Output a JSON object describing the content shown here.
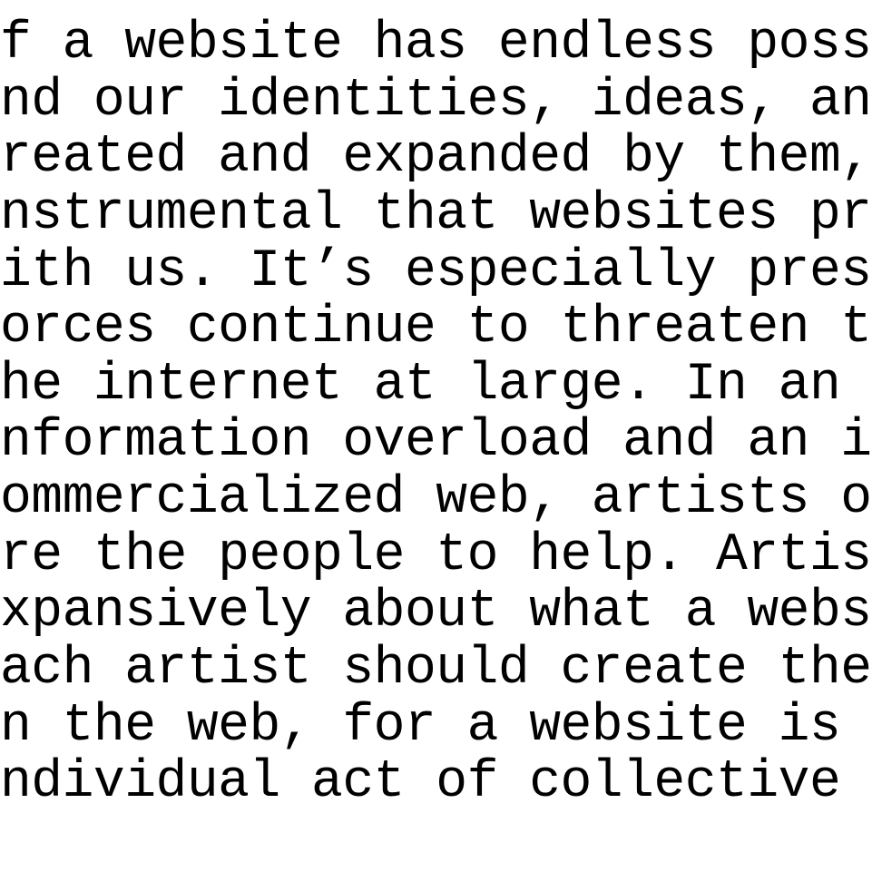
{
  "content": {
    "lines": [
      "f a website has endless possibiliti",
      "nd our identities, ideas, and dream",
      "reated and expanded by them, then i",
      "nstrumental that websites progress",
      "ith us. It’s especially pressing wh",
      "orces continue to threaten the web",
      "he internet at large. In an age of",
      "nformation overload and an increasi",
      "ommercialized web, artists of all t",
      "re the people to help. Artists can",
      "xpansively about what a website car",
      "ach artist should create their own",
      "n the web, for a website is an",
      "ndividual act of collective ambitio"
    ]
  }
}
